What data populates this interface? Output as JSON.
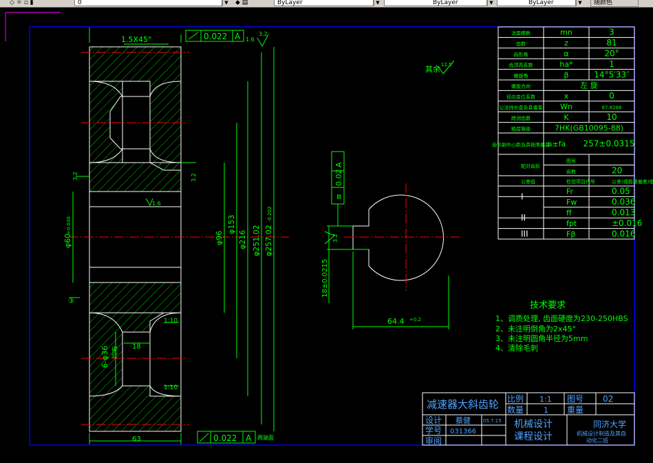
{
  "toolbar": {
    "layer_value": "0",
    "color_value": "ByLayer",
    "linetype_value": "ByLayer",
    "lineweight_value": "ByLayer",
    "plotstyle_value": "随颜色"
  },
  "drawing": {
    "chamfer": "1.5X45°",
    "tol_top": "0.022",
    "tol_bottom": "0.022",
    "datum_a": "A",
    "rough_16": "1.6",
    "rough_32": "3.2",
    "rough_125": "12.5",
    "rest_label": "其余",
    "dim_phi216": "φ216",
    "dim_phi153": "φ153",
    "dim_phi96": "φ96",
    "dim_phi25102": "φ251.02",
    "dim_phi25702": "φ257.02",
    "dim_phi257_tol": "-0.202",
    "dim_bore": "φ60",
    "dim_bore_tol": "+0.030",
    "dim_holes": "6-φ36",
    "dim_holes_note": "均布",
    "dim_18": "18",
    "dim_63": "63",
    "slope1": "1:10",
    "slope2": "1:10",
    "both_ends": "两端面",
    "key_depth": "18±0.0215",
    "key_len": "64.4",
    "key_len_tol": "+0.2",
    "tol_side": "0.02",
    "sym_mark": "≡",
    "circle_mark": "③"
  },
  "params": {
    "rows": [
      {
        "name": "法面模数",
        "sym": "mn",
        "val": "3"
      },
      {
        "name": "齿数",
        "sym": "z",
        "val": "81"
      },
      {
        "name": "齿形角",
        "sym": "α",
        "val": "20°"
      },
      {
        "name": "齿顶高系数",
        "sym": "ha*",
        "val": "1"
      },
      {
        "name": "螺旋角",
        "sym": "β",
        "val": "14°5′33″"
      },
      {
        "name": "螺旋方向",
        "sym": "",
        "val": "左 旋"
      },
      {
        "name": "径向变位系数",
        "sym": "x",
        "val": "0"
      },
      {
        "name": "公法线长度及其偏差",
        "sym": "Wn",
        "val": "87.8288"
      },
      {
        "name": "跨测齿数",
        "sym": "K",
        "val": "10"
      },
      {
        "name": "精度等级",
        "sym": "",
        "val": "7HK(GB10095-88)"
      },
      {
        "name": "齿轮副中心距及其极限偏差",
        "sym": "a±fa",
        "val": "257±0.0315"
      }
    ],
    "mating_label": "配对齿轮",
    "mating_no": "图号",
    "mating_teeth": "齿数",
    "mating_teeth_val": "20",
    "grp_hdr": "公差组",
    "item_hdr": "检验项目代号",
    "val_hdr": "公差(或极限偏差)值",
    "grp1": "I",
    "grp2": "II",
    "grp3": "III",
    "fr": "Fr",
    "fr_val": "0.05",
    "fw": "Fw",
    "fw_val": "0.036",
    "ff": "ff",
    "ff_val": "0.013",
    "fpt": "fpt",
    "fpt_val": "±0.016",
    "fb": "Fβ",
    "fb_val": "0.016"
  },
  "tech": {
    "title": "技术要求",
    "items": [
      "1、调质处理, 齿面硬度为230-250HBS",
      "2、未注明倒角为2x45°",
      "3、未注明圆角半径为5mm",
      "4、清除毛刺"
    ]
  },
  "title_block": {
    "part_name": "减速器大斜齿轮",
    "scale_label": "比例",
    "scale_val": "1:1",
    "drawing_no_label": "图号",
    "drawing_no_val": "02",
    "qty_label": "数量",
    "qty_val": "1",
    "weight_label": "重量",
    "design_label": "设计",
    "designer": "蔡健",
    "date": "05.7.15",
    "student_no_label": "学号",
    "student_no": "031366",
    "review_label": "审阅",
    "course1": "机械设计",
    "course2": "课程设计",
    "univ": "同济大学",
    "dept1": "机械设计制造及其自",
    "dept2": "动化二班"
  }
}
